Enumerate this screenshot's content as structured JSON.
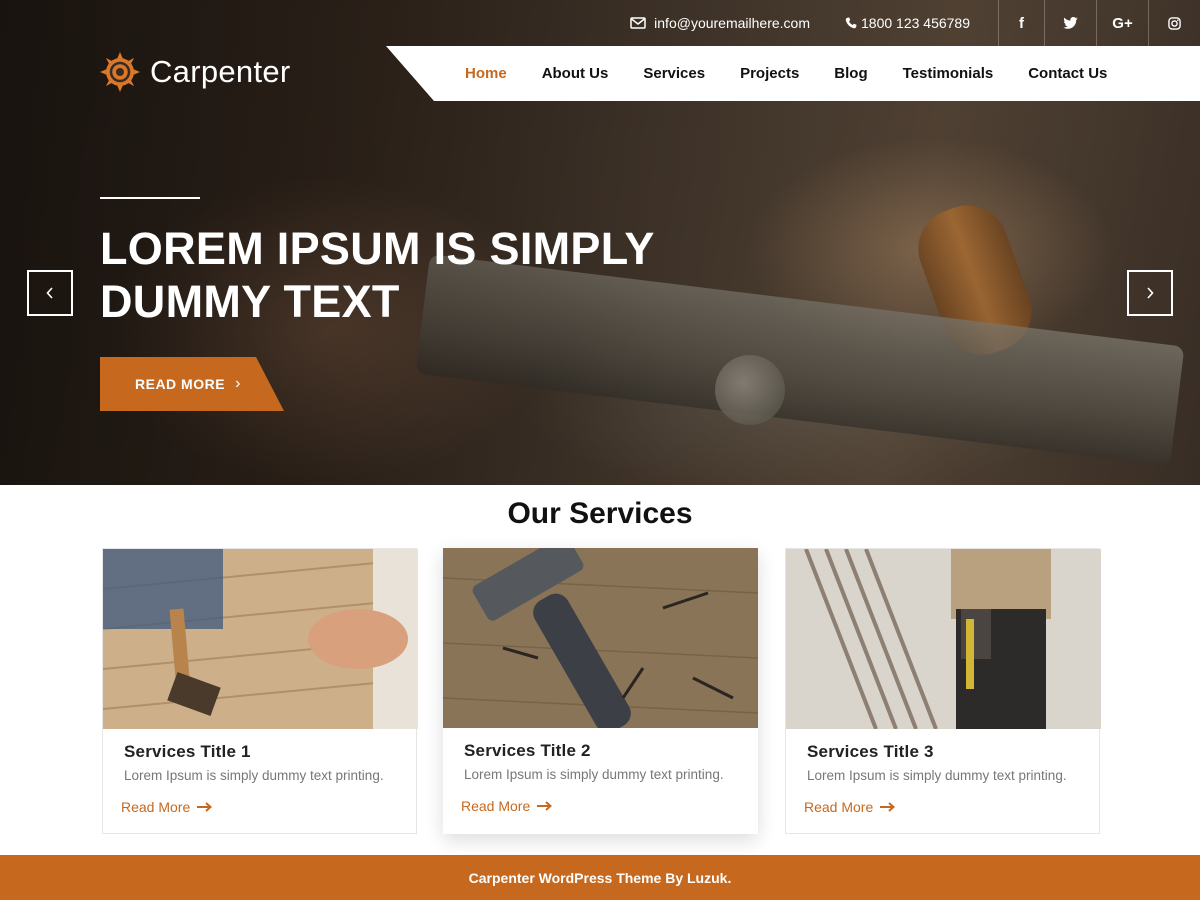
{
  "topbar": {
    "email": "info@youremailhere.com",
    "phone": "1800 123 456789",
    "social": [
      {
        "icon": "facebook-icon",
        "glyph": "f"
      },
      {
        "icon": "twitter-icon",
        "glyph": ""
      },
      {
        "icon": "google-plus-icon",
        "glyph": "G+"
      },
      {
        "icon": "instagram-icon",
        "glyph": ""
      }
    ]
  },
  "logo": {
    "text": "Carpenter",
    "icon": "saw-blade-icon"
  },
  "nav": {
    "items": [
      {
        "label": "Home",
        "active": true
      },
      {
        "label": "About Us"
      },
      {
        "label": "Services"
      },
      {
        "label": "Projects"
      },
      {
        "label": "Blog"
      },
      {
        "label": "Testimonials"
      },
      {
        "label": "Contact Us"
      }
    ]
  },
  "hero": {
    "title": "LOREM IPSUM IS SIMPLY DUMMY TEXT",
    "button_label": "READ MORE",
    "prev_icon": "chevron-left-icon",
    "next_icon": "chevron-right-icon"
  },
  "services": {
    "heading": "Our Services",
    "cards": [
      {
        "title": "Services Title 1",
        "text": "Lorem Ipsum is simply dummy text printing.",
        "link": "Read More"
      },
      {
        "title": "Services Title 2",
        "text": "Lorem Ipsum is simply dummy text printing.",
        "link": "Read More"
      },
      {
        "title": "Services Title 3",
        "text": "Lorem Ipsum is simply dummy text printing.",
        "link": "Read More"
      }
    ]
  },
  "footer": {
    "text": "Carpenter WordPress Theme By Luzuk."
  },
  "colors": {
    "accent": "#c6691f",
    "nav_bg": "#ffffff",
    "text_dark": "#111111",
    "text_muted": "#777777"
  }
}
